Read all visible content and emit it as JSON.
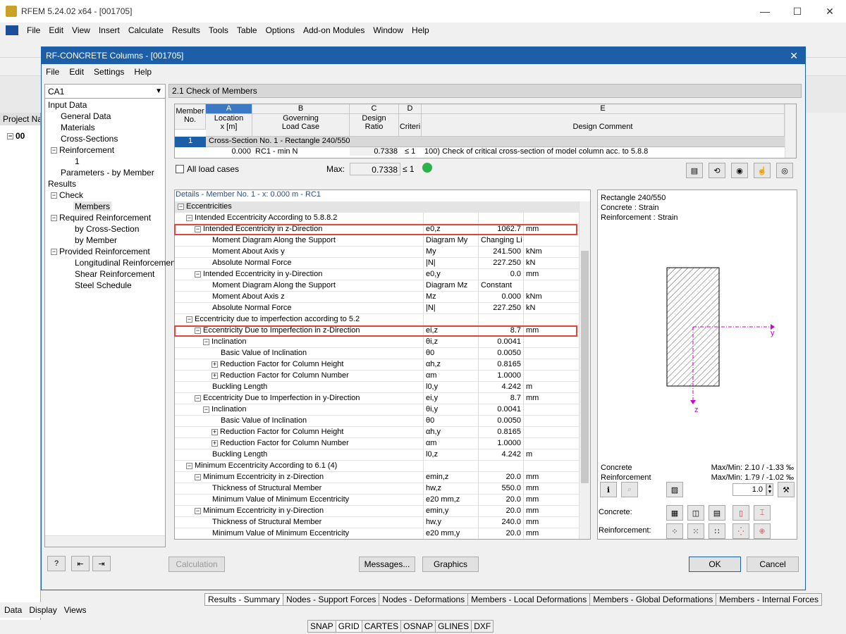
{
  "app": {
    "title": "RFEM 5.24.02 x64 - [001705]"
  },
  "menu": [
    "File",
    "Edit",
    "View",
    "Insert",
    "Calculate",
    "Results",
    "Tools",
    "Table",
    "Options",
    "Add-on Modules",
    "Window",
    "Help"
  ],
  "left_panel": {
    "header": "Project Na",
    "root": "00",
    "tabs": [
      "Data",
      "Display",
      "Views"
    ]
  },
  "dialog": {
    "title": "RF-CONCRETE Columns - [001705]",
    "menu": [
      "File",
      "Edit",
      "Settings",
      "Help"
    ],
    "case_select": "CA1",
    "tree": {
      "input_data": "Input Data",
      "general_data": "General Data",
      "materials": "Materials",
      "cross_sections": "Cross-Sections",
      "reinforcement": "Reinforcement",
      "reinforcement_1": "1",
      "parameters": "Parameters - by Member",
      "results": "Results",
      "check": "Check",
      "members": "Members",
      "required_reinforcement": "Required Reinforcement",
      "by_cross_section": "by Cross-Section",
      "by_member": "by Member",
      "provided_reinforcement": "Provided Reinforcement",
      "longitudinal": "Longitudinal Reinforcement",
      "shear": "Shear Reinforcement",
      "steel_schedule": "Steel Schedule"
    },
    "section_title": "2.1 Check of Members",
    "table": {
      "col_letters": [
        "A",
        "B",
        "C",
        "D",
        "E"
      ],
      "member_header": [
        "Member",
        "No."
      ],
      "headers": [
        [
          "Location",
          "x [m]"
        ],
        [
          "Governing",
          "Load Case"
        ],
        [
          "Design",
          "Ratio"
        ],
        [
          "",
          "Criteri"
        ],
        [
          "",
          "Design Comment"
        ]
      ],
      "group_row": {
        "no": "1",
        "label": "Cross-Section No. 1 - Rectangle 240/550"
      },
      "row": {
        "x": "0.000",
        "load_case": "RC1 - min N",
        "ratio": "0.7338",
        "criteria": "≤ 1",
        "comment": "100) Check of critical cross-section of model column acc. to 5.8.8"
      }
    },
    "all_load_cases_label": "All load cases",
    "max_label": "Max:",
    "max_value": "0.7338",
    "max_criteria": "≤ 1",
    "details_header": "Details  -  Member No. 1  -  x: 0.000 m  -  RC1",
    "details": [
      {
        "level": 0,
        "exp": "−",
        "label": "Eccentricities",
        "sym": "",
        "val": "",
        "unit": "",
        "group": true
      },
      {
        "level": 1,
        "exp": "−",
        "label": "Intended Eccentricity According to 5.8.8.2",
        "sym": "",
        "val": "",
        "unit": ""
      },
      {
        "level": 2,
        "exp": "−",
        "label": "Intended Eccentricity in z-Direction",
        "sym": "e0,z",
        "val": "1062.7",
        "unit": "mm"
      },
      {
        "level": 3,
        "exp": "",
        "label": "Moment Diagram Along the Support",
        "sym": "Diagram My",
        "val": "Changing Li",
        "unit": "",
        "left": true
      },
      {
        "level": 3,
        "exp": "",
        "label": "Moment About Axis y",
        "sym": "My",
        "val": "241.500",
        "unit": "kNm"
      },
      {
        "level": 3,
        "exp": "",
        "label": "Absolute Normal Force",
        "sym": "|N|",
        "val": "227.250",
        "unit": "kN"
      },
      {
        "level": 2,
        "exp": "−",
        "label": "Intended Eccentricity in y-Direction",
        "sym": "e0,y",
        "val": "0.0",
        "unit": "mm"
      },
      {
        "level": 3,
        "exp": "",
        "label": "Moment Diagram Along the Support",
        "sym": "Diagram Mz",
        "val": "Constant",
        "unit": "",
        "left": true
      },
      {
        "level": 3,
        "exp": "",
        "label": "Moment About Axis z",
        "sym": "Mz",
        "val": "0.000",
        "unit": "kNm"
      },
      {
        "level": 3,
        "exp": "",
        "label": "Absolute Normal Force",
        "sym": "|N|",
        "val": "227.250",
        "unit": "kN"
      },
      {
        "level": 1,
        "exp": "−",
        "label": "Eccentricity due to imperfection according to 5.2",
        "sym": "",
        "val": "",
        "unit": ""
      },
      {
        "level": 2,
        "exp": "−",
        "label": "Eccentricity Due to Imperfection in z-Direction",
        "sym": "ei,z",
        "val": "8.7",
        "unit": "mm"
      },
      {
        "level": 3,
        "exp": "−",
        "label": "Inclination",
        "sym": "θi,z",
        "val": "0.0041",
        "unit": ""
      },
      {
        "level": 4,
        "exp": "",
        "label": "Basic Value of Inclination",
        "sym": "θ0",
        "val": "0.0050",
        "unit": ""
      },
      {
        "level": 4,
        "exp": "+",
        "label": "Reduction Factor for Column Height",
        "sym": "αh,z",
        "val": "0.8165",
        "unit": ""
      },
      {
        "level": 4,
        "exp": "+",
        "label": "Reduction Factor for Column Number",
        "sym": "αm",
        "val": "1.0000",
        "unit": ""
      },
      {
        "level": 3,
        "exp": "",
        "label": "Buckling Length",
        "sym": "l0,y",
        "val": "4.242",
        "unit": "m"
      },
      {
        "level": 2,
        "exp": "−",
        "label": "Eccentricity Due to Imperfection in y-Direction",
        "sym": "ei,y",
        "val": "8.7",
        "unit": "mm"
      },
      {
        "level": 3,
        "exp": "−",
        "label": "Inclination",
        "sym": "θi,y",
        "val": "0.0041",
        "unit": ""
      },
      {
        "level": 4,
        "exp": "",
        "label": "Basic Value of Inclination",
        "sym": "θ0",
        "val": "0.0050",
        "unit": ""
      },
      {
        "level": 4,
        "exp": "+",
        "label": "Reduction Factor for Column Height",
        "sym": "αh,y",
        "val": "0.8165",
        "unit": ""
      },
      {
        "level": 4,
        "exp": "+",
        "label": "Reduction Factor for Column Number",
        "sym": "αm",
        "val": "1.0000",
        "unit": ""
      },
      {
        "level": 3,
        "exp": "",
        "label": "Buckling Length",
        "sym": "l0,z",
        "val": "4.242",
        "unit": "m"
      },
      {
        "level": 1,
        "exp": "−",
        "label": "Minimum Eccentricity According to 6.1 (4)",
        "sym": "",
        "val": "",
        "unit": ""
      },
      {
        "level": 2,
        "exp": "−",
        "label": "Minimum Eccentricity in z-Direction",
        "sym": "emin,z",
        "val": "20.0",
        "unit": "mm"
      },
      {
        "level": 3,
        "exp": "",
        "label": "Thickness of Structural Member",
        "sym": "hw,z",
        "val": "550.0",
        "unit": "mm"
      },
      {
        "level": 3,
        "exp": "",
        "label": "Minimum Value of Minimum Eccentricity",
        "sym": "e20 mm,z",
        "val": "20.0",
        "unit": "mm"
      },
      {
        "level": 2,
        "exp": "−",
        "label": "Minimum Eccentricity in y-Direction",
        "sym": "emin,y",
        "val": "20.0",
        "unit": "mm"
      },
      {
        "level": 3,
        "exp": "",
        "label": "Thickness of Structural Member",
        "sym": "hw,y",
        "val": "240.0",
        "unit": "mm"
      },
      {
        "level": 3,
        "exp": "",
        "label": "Minimum Value of Minimum Eccentricity",
        "sym": "e20 mm,y",
        "val": "20.0",
        "unit": "mm"
      }
    ],
    "graphic": {
      "line1": "Rectangle 240/550",
      "line2": "Concrete : Strain",
      "line3": "Reinforcement : Strain",
      "axis_y": "y",
      "axis_z": "z",
      "concrete_label": "Concrete",
      "reinforcement_label": "Reinforcement",
      "concrete_maxmin": "Max/Min: 2.10 / -1.33 ‰",
      "reinforcement_maxmin": "Max/Min: 1.79 / -1.02 ‰",
      "scale": "1.0",
      "concrete_row": "Concrete:",
      "reinforcement_row": "Reinforcement:"
    },
    "buttons": {
      "calculation": "Calculation",
      "messages": "Messages...",
      "graphics": "Graphics",
      "ok": "OK",
      "cancel": "Cancel"
    }
  },
  "bottom_tabs": [
    "Results - Summary",
    "Nodes - Support Forces",
    "Nodes - Deformations",
    "Members - Local Deformations",
    "Members - Global Deformations",
    "Members - Internal Forces"
  ],
  "status": [
    "SNAP",
    "GRID",
    "CARTES",
    "OSNAP",
    "GLINES",
    "DXF"
  ]
}
